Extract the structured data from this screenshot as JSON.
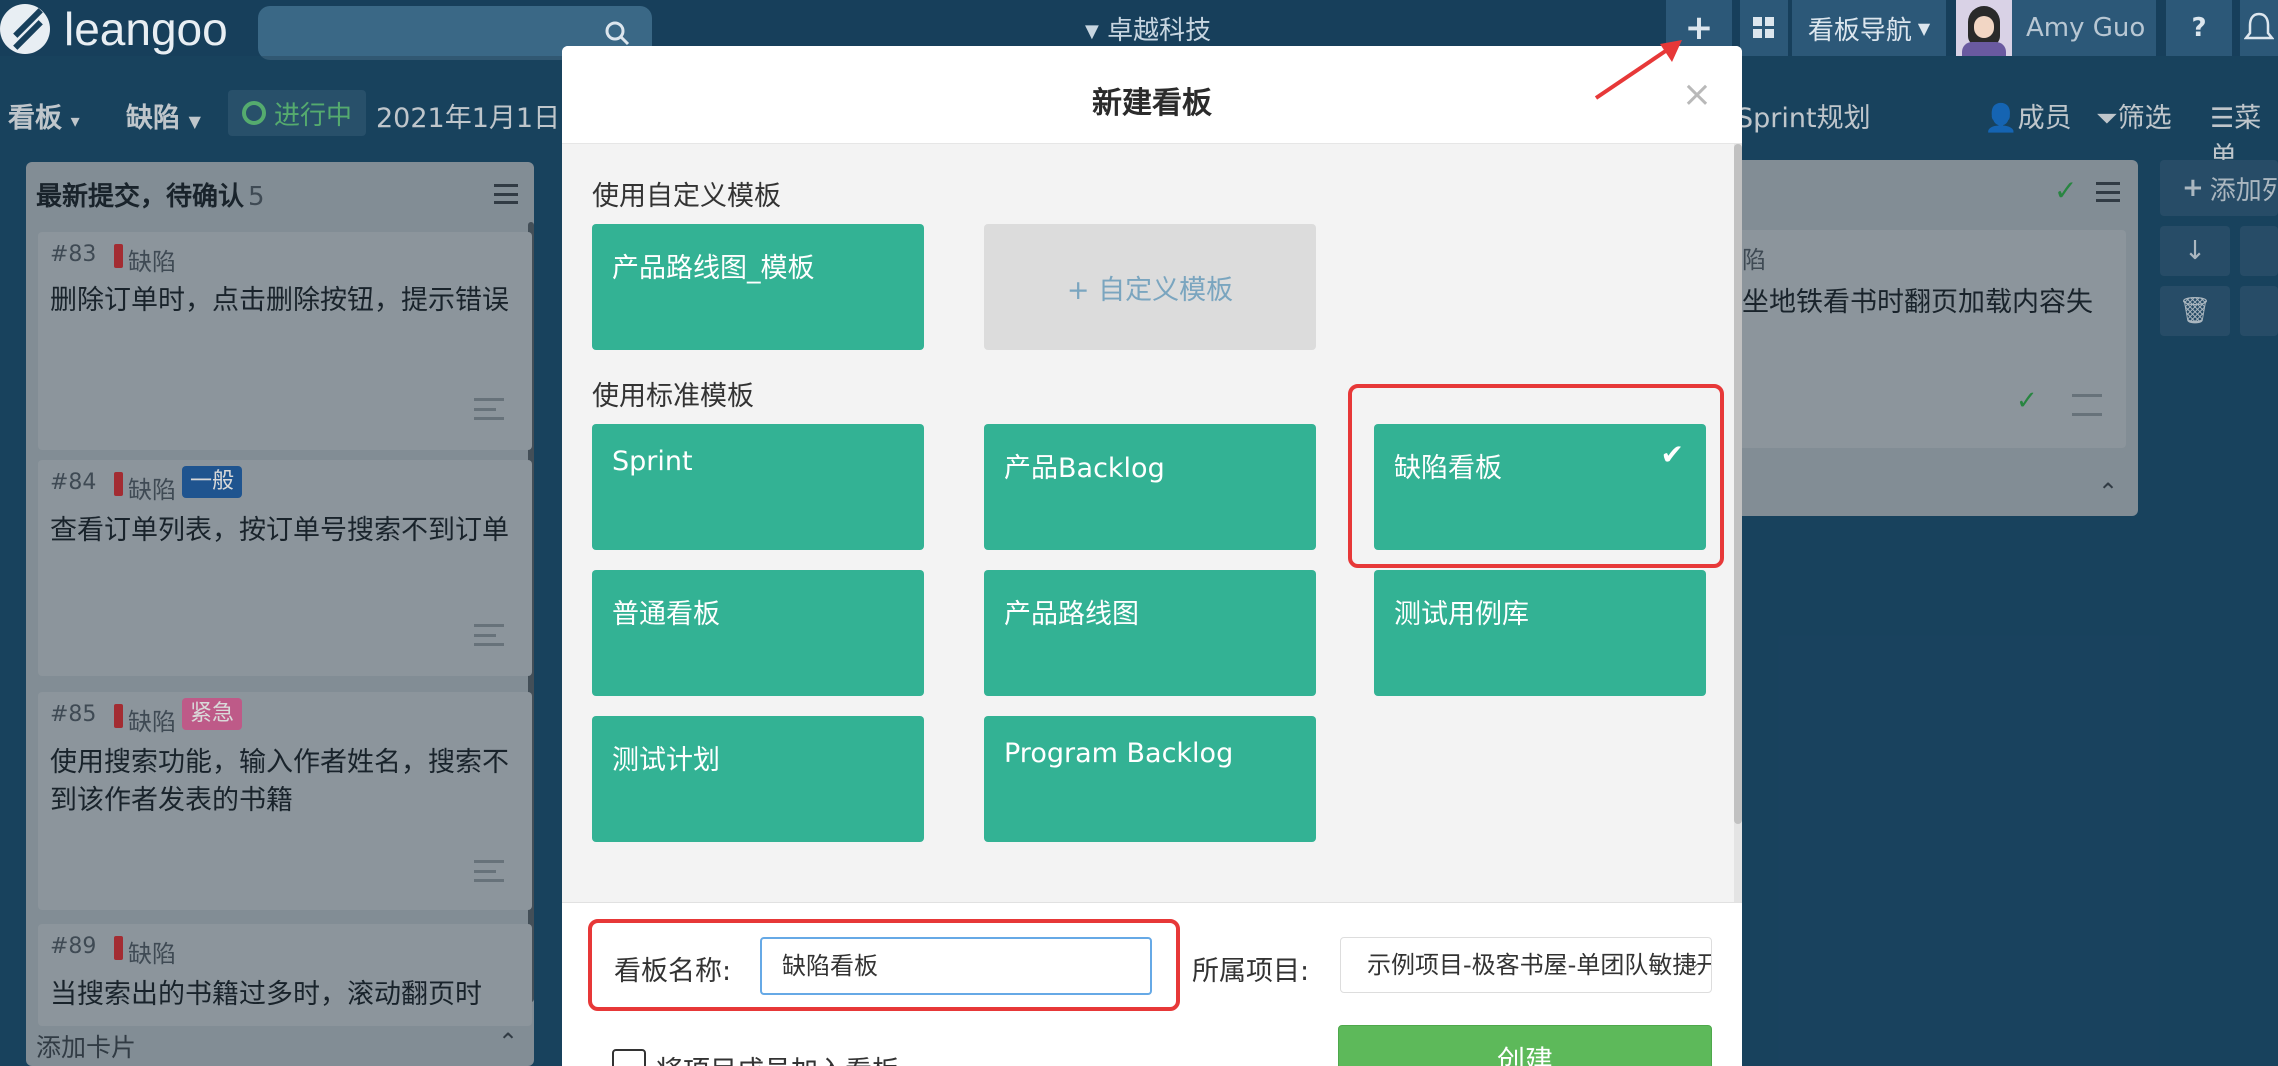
{
  "topbar": {
    "logo_text": "leangoo",
    "org_name": "卓越科技",
    "board_nav": "看板导航",
    "user_name": "Amy Guo",
    "help": "?",
    "plus": "+"
  },
  "subbar": {
    "board_menu": "看板",
    "board_name": "缺陷",
    "status": "进行中",
    "date": "2021年1月1日",
    "sprint_plan": "Sprint规划",
    "members": "成员",
    "filter": "筛选",
    "menu": "菜单"
  },
  "column": {
    "title": "最新提交，待确认",
    "count": "5",
    "footer": "添加卡片",
    "cards": [
      {
        "num": "#83",
        "type": "缺陷",
        "badge": "",
        "text": "删除订单时，点击删除按钮，提示错误"
      },
      {
        "num": "#84",
        "type": "缺陷",
        "badge": "一般",
        "text": "查看订单列表，按订单号搜索不到订单"
      },
      {
        "num": "#85",
        "type": "缺陷",
        "badge": "紧急",
        "text": "使用搜索功能，输入作者姓名，搜索不到该作者发表的书籍"
      },
      {
        "num": "#89",
        "type": "缺陷",
        "badge": "",
        "text": "当搜索出的书籍过多时，滚动翻页时"
      }
    ]
  },
  "right_card": {
    "type": "陷",
    "text": "坐地铁看书时翻页加载内容失",
    "add_label": "添加列"
  },
  "modal": {
    "title": "新建看板",
    "close": "×",
    "custom_section": "使用自定义模板",
    "custom_templates": [
      "产品路线图_模板"
    ],
    "add_custom": "+ 自定义模板",
    "standard_section": "使用标准模板",
    "standard_templates": [
      "Sprint",
      "产品Backlog",
      "缺陷看板",
      "普通看板",
      "产品路线图",
      "测试用例库",
      "测试计划",
      "Program Backlog"
    ],
    "selected_template": "缺陷看板",
    "name_label": "看板名称:",
    "name_value": "缺陷看板",
    "project_label": "所属项目:",
    "project_value": "示例项目-极客书屋-单团队敏捷开发",
    "add_members_label": "将项目成员加入看板",
    "create_button": "创建"
  },
  "colors": {
    "teal": "#33b294",
    "create_green": "#5db95a",
    "highlight_red": "#e73838",
    "topbar": "#173f5b"
  }
}
